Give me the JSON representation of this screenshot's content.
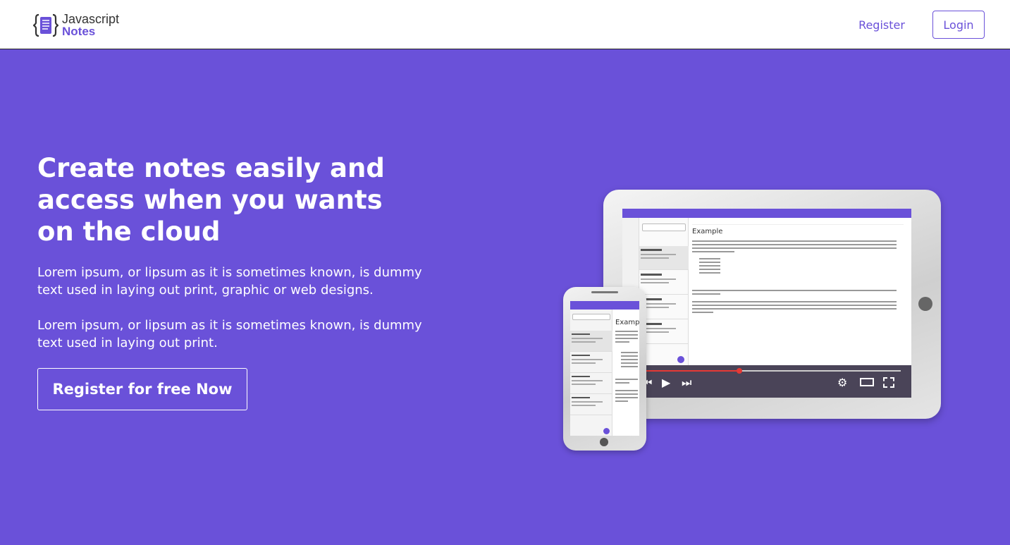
{
  "header": {
    "logo": {
      "line1": "Javascript",
      "line2": "Notes",
      "icon": "notes-braces-icon"
    },
    "nav": {
      "register_label": "Register",
      "login_label": "Login"
    }
  },
  "hero": {
    "title": "Create notes easily and access when you wants on the cloud",
    "paragraphs": [
      "Lorem ipsum, or lipsum as it is sometimes known, is dummy text used in laying out print, graphic or web designs.",
      "Lorem ipsum, or lipsum as it is sometimes known, is dummy text used in laying out print."
    ],
    "cta_label": "Register for free Now"
  },
  "illustration": {
    "tablet_note_heading": "Example",
    "phone_note_heading": "Example",
    "video_progress": 0.38,
    "video_icons": [
      "skip-back-icon",
      "play-icon",
      "skip-forward-icon",
      "settings-icon",
      "theater-mode-icon",
      "fullscreen-icon"
    ]
  },
  "colors": {
    "primary": "#6a51d9",
    "header_bg": "#ffffff",
    "text_on_primary": "#ffffff"
  }
}
